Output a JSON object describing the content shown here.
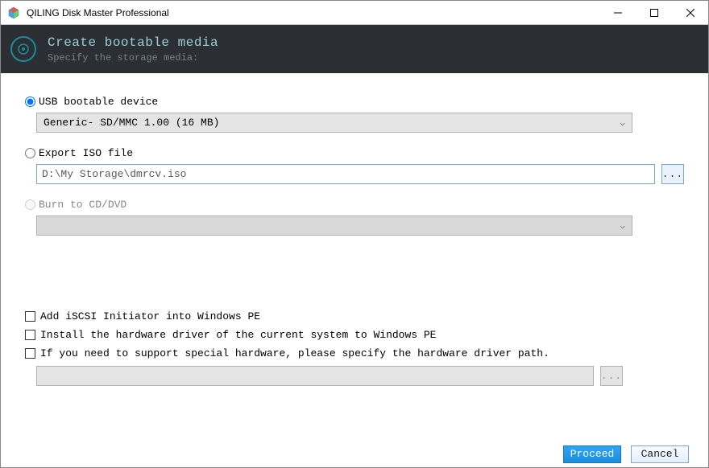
{
  "window": {
    "title": "QILING Disk Master Professional"
  },
  "header": {
    "title": "Create bootable media",
    "subtitle": "Specify the storage media:"
  },
  "options": {
    "usb": {
      "label": "USB bootable device",
      "selected": true,
      "device": "Generic- SD/MMC 1.00 (16 MB)"
    },
    "iso": {
      "label": "Export ISO file",
      "selected": false,
      "path": "D:\\My Storage\\dmrcv.iso"
    },
    "burn": {
      "label": "Burn to CD/DVD",
      "selected": false,
      "enabled": false,
      "device": ""
    }
  },
  "checks": {
    "iscsi": {
      "label": "Add iSCSI Initiator into Windows PE",
      "checked": false
    },
    "driver_current": {
      "label": "Install the hardware driver of the current system to Windows PE",
      "checked": false
    },
    "driver_special": {
      "label": "If you need to support special hardware, please specify the hardware driver path.",
      "checked": false,
      "path": ""
    }
  },
  "footer": {
    "proceed": "Proceed",
    "cancel": "Cancel"
  },
  "browse": "..."
}
